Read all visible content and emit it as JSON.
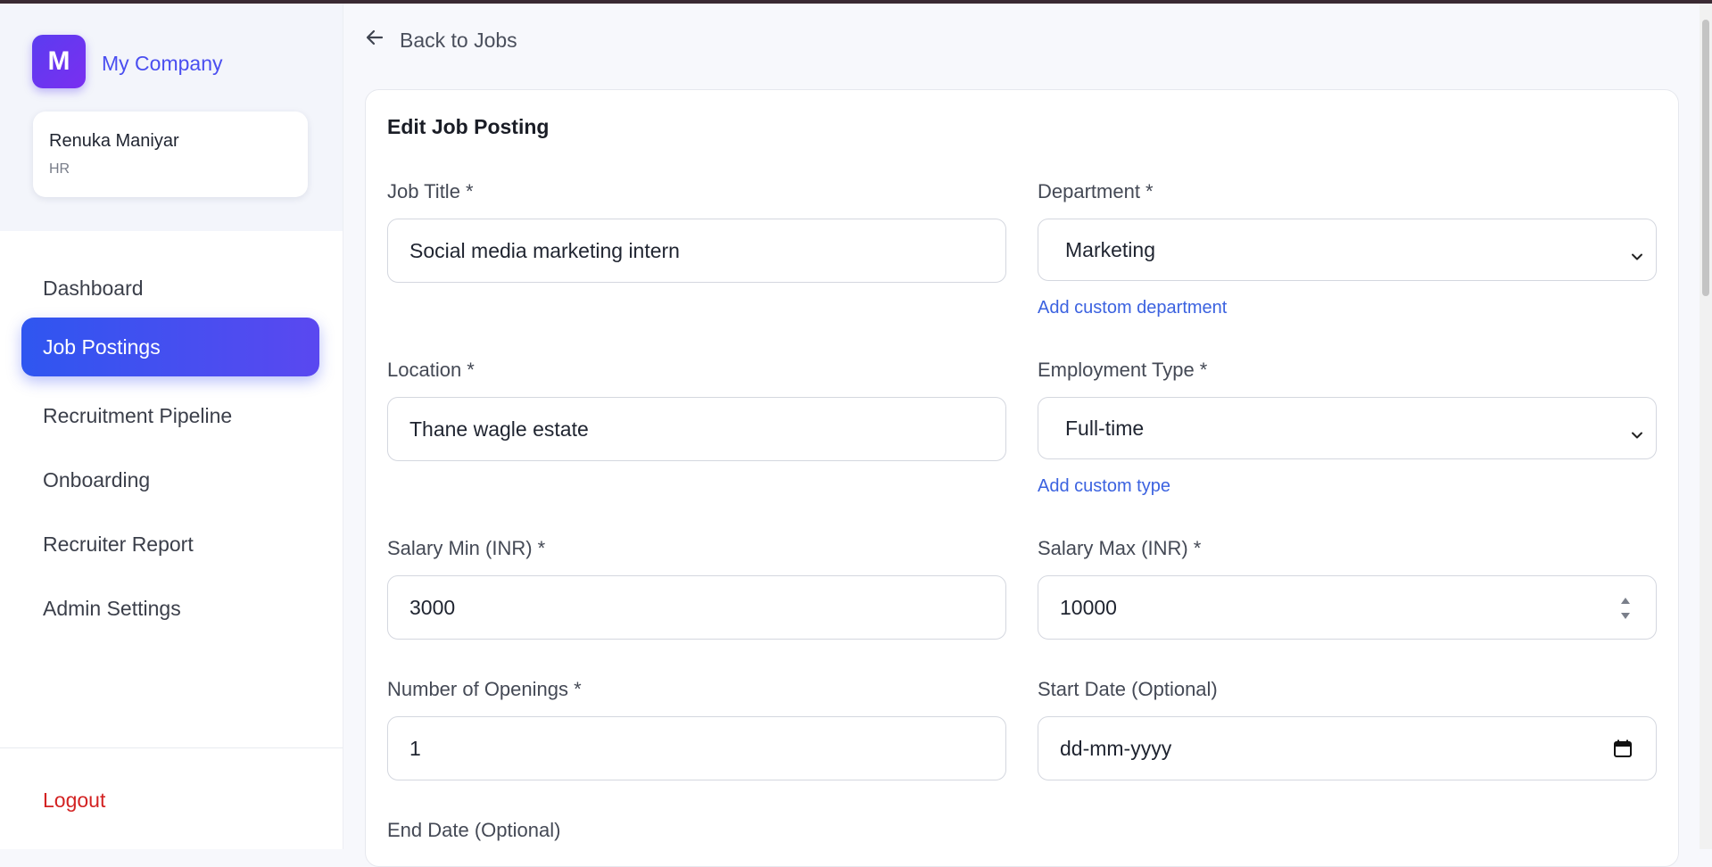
{
  "sidebar": {
    "logo_letter": "M",
    "company_name": "My Company",
    "user": {
      "name": "Renuka Maniyar",
      "role": "HR"
    },
    "items": [
      {
        "label": "Dashboard",
        "active": false
      },
      {
        "label": "Job Postings",
        "active": true
      },
      {
        "label": "Recruitment Pipeline",
        "active": false
      },
      {
        "label": "Onboarding",
        "active": false
      },
      {
        "label": "Recruiter Report",
        "active": false
      },
      {
        "label": "Admin Settings",
        "active": false
      }
    ],
    "logout_label": "Logout"
  },
  "header": {
    "back_label": "Back to Jobs",
    "back_icon": "arrow-left-icon"
  },
  "form": {
    "title": "Edit Job Posting",
    "job_title": {
      "label": "Job Title *",
      "value": "Social media marketing intern"
    },
    "department": {
      "label": "Department *",
      "value": "Marketing",
      "link": "Add custom department"
    },
    "location": {
      "label": "Location *",
      "value": "Thane wagle estate"
    },
    "employment_type": {
      "label": "Employment Type *",
      "value": "Full-time",
      "link": "Add custom type"
    },
    "salary_min": {
      "label": "Salary Min (INR) *",
      "value": "3000"
    },
    "salary_max": {
      "label": "Salary Max (INR) *",
      "value": "10000"
    },
    "openings": {
      "label": "Number of Openings *",
      "value": "1"
    },
    "start_date": {
      "label": "Start Date (Optional)",
      "placeholder": "dd-mm-yyyy"
    },
    "end_date": {
      "label": "End Date (Optional)"
    }
  },
  "colors": {
    "accent": "#3b5bf0",
    "logout": "#d32222",
    "link": "#3b62e0"
  }
}
